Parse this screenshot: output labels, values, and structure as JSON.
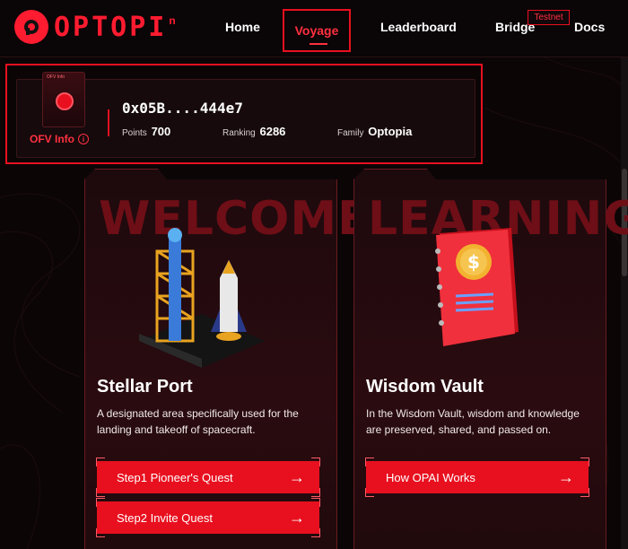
{
  "nav": {
    "logo_text": "OPTOPI",
    "logo_sup": "n",
    "items": [
      "Home",
      "Voyage",
      "Leaderboard",
      "Bridge",
      "Docs"
    ],
    "testnet_badge": "Testnet"
  },
  "profile": {
    "badge_label": "OFV Info",
    "ofv_info": "OFV Info",
    "info_icon": "i",
    "address": "0x05B....444e7",
    "points_label": "Points",
    "points_value": "700",
    "ranking_label": "Ranking",
    "ranking_value": "6286",
    "family_label": "Family",
    "family_value": "Optopia"
  },
  "cards": [
    {
      "bg_word": "WELCOME",
      "title": "Stellar Port",
      "desc": "A designated area specifically used for the landing and takeoff of spacecraft.",
      "buttons": [
        "Step1 Pioneer's Quest",
        "Step2 Invite Quest"
      ]
    },
    {
      "bg_word": "LEARNING",
      "title": "Wisdom Vault",
      "desc": "In the Wisdom Vault, wisdom and knowledge are preserved, shared, and passed on.",
      "buttons": [
        "How OPAI Works"
      ]
    }
  ],
  "arrow": "→",
  "colors": {
    "accent": "#e8101f",
    "bg": "#0b0506"
  }
}
